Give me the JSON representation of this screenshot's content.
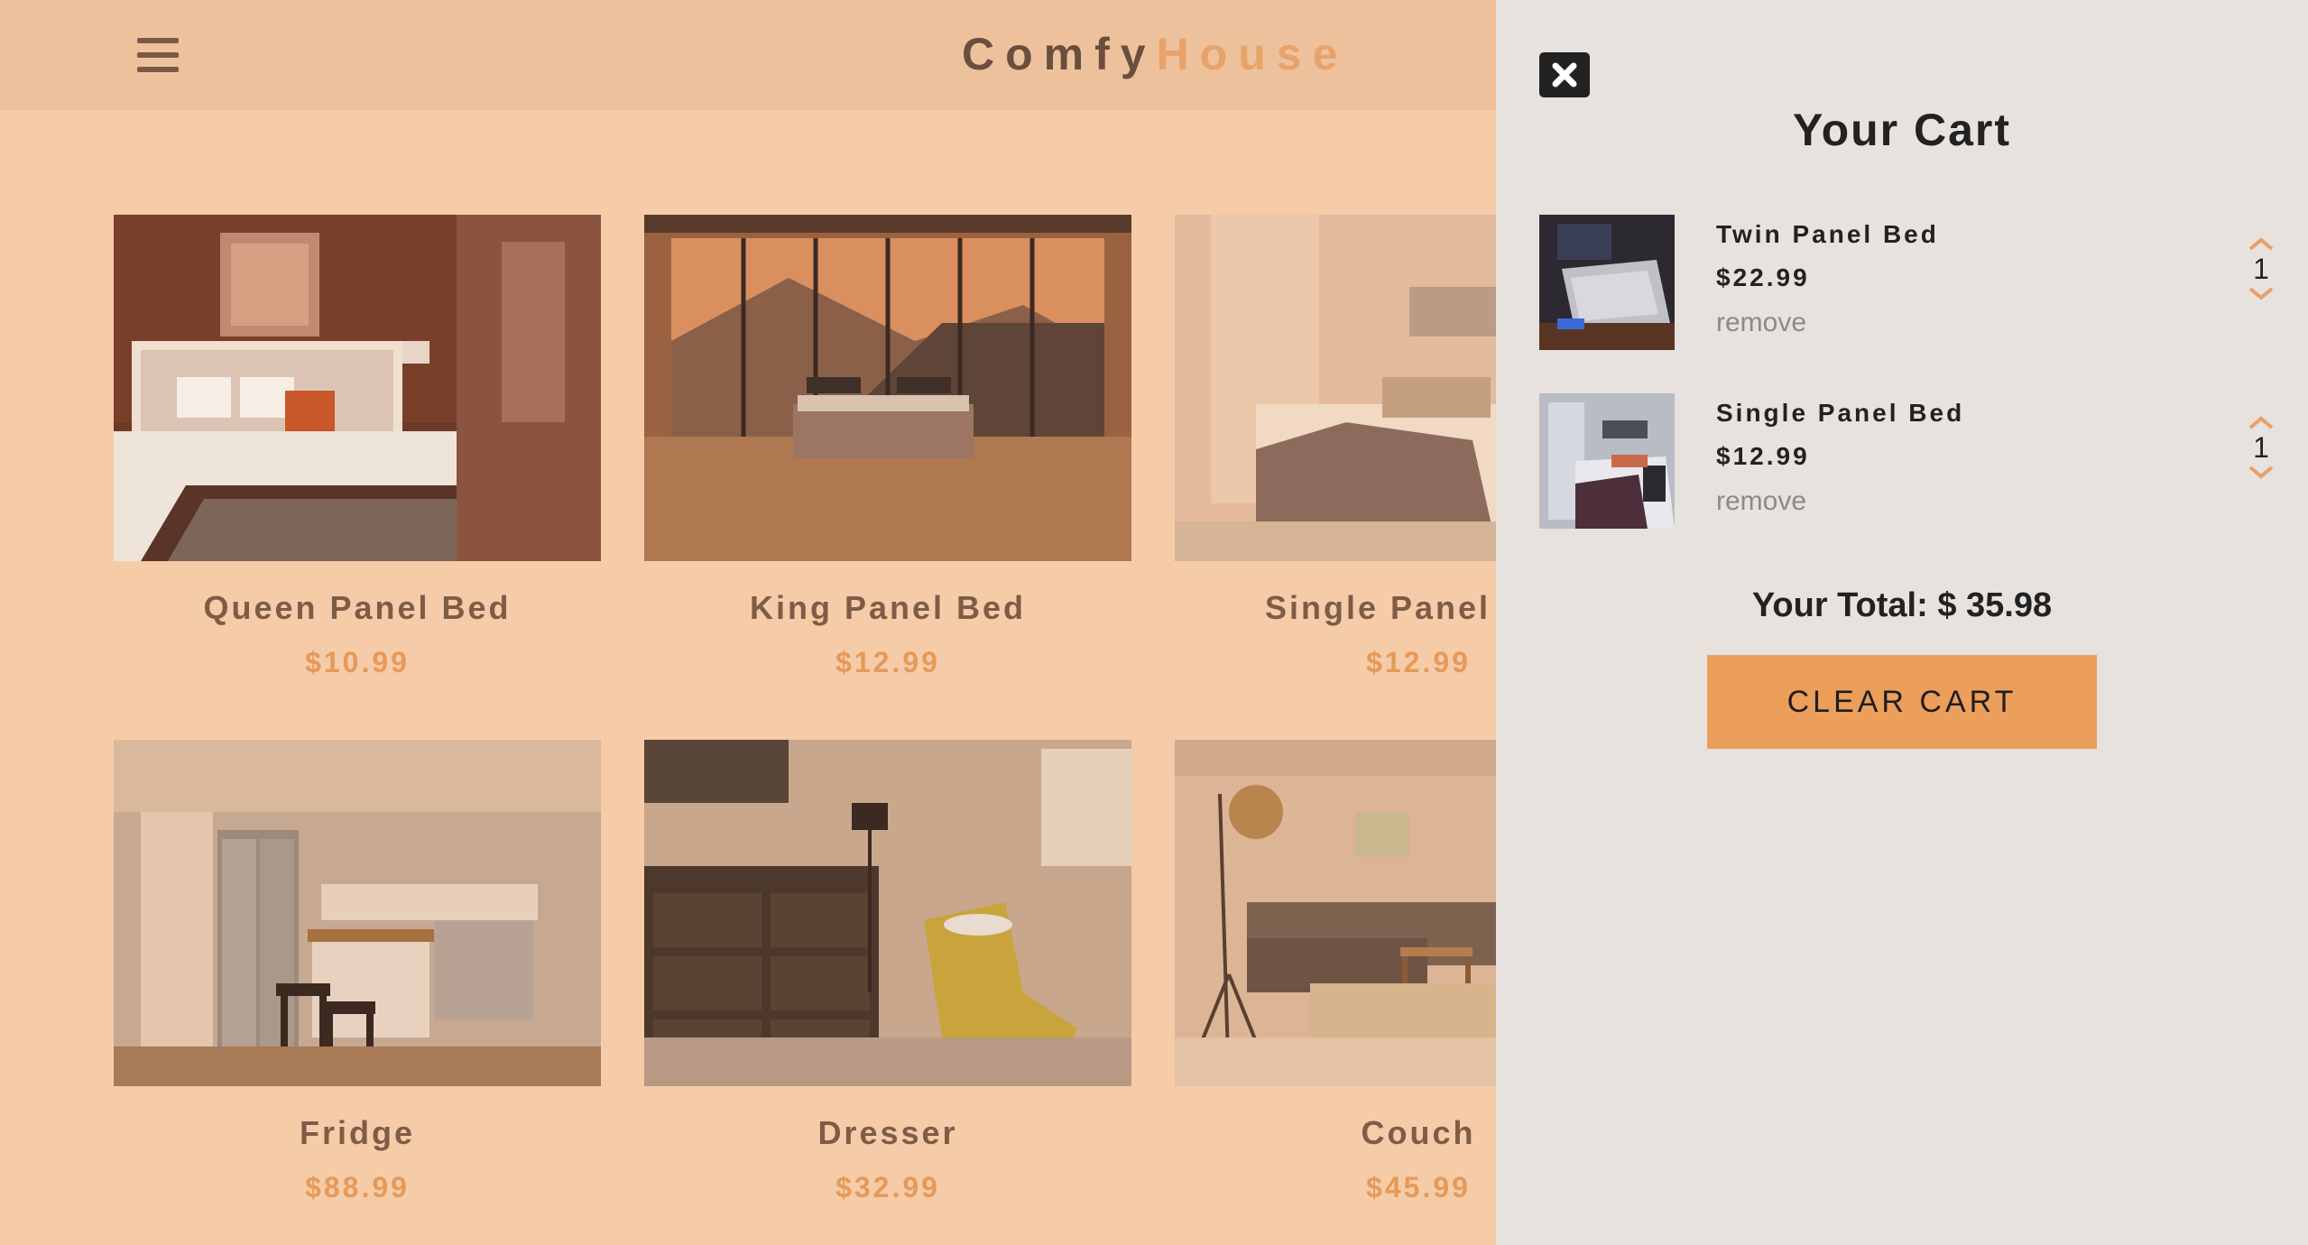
{
  "navbar": {
    "logo_part1": "Comfy",
    "logo_part2": "House",
    "menu_icon": "menu-icon"
  },
  "products": [
    {
      "name": "Queen Panel Bed",
      "price": "$10.99",
      "image": "bedroom-queen-bed"
    },
    {
      "name": "King Panel Bed",
      "price": "$12.99",
      "image": "bedroom-mountain-view"
    },
    {
      "name": "Single Panel Bed",
      "price": "$12.99",
      "image": "bedroom-white-bed"
    },
    {
      "name": "Fridge",
      "price": "$88.99",
      "image": "kitchen-fridge"
    },
    {
      "name": "Dresser",
      "price": "$32.99",
      "image": "room-dresser-chair"
    },
    {
      "name": "Couch",
      "price": "$45.99",
      "image": "living-room-couch"
    }
  ],
  "cart": {
    "title": "Your Cart",
    "close_icon": "close-icon",
    "items": [
      {
        "name": "Twin Panel Bed",
        "price": "$22.99",
        "remove_label": "remove",
        "quantity": "1"
      },
      {
        "name": "Single Panel Bed",
        "price": "$12.99",
        "remove_label": "remove",
        "quantity": "1"
      }
    ],
    "total": "Your Total: $ 35.98",
    "clear_label": "CLEAR CART"
  },
  "colors": {
    "page_bg": "#f6cba8",
    "navbar_bg": "#eec19d",
    "accent": "#ec9e5b",
    "cart_bg": "#e7e2de"
  }
}
